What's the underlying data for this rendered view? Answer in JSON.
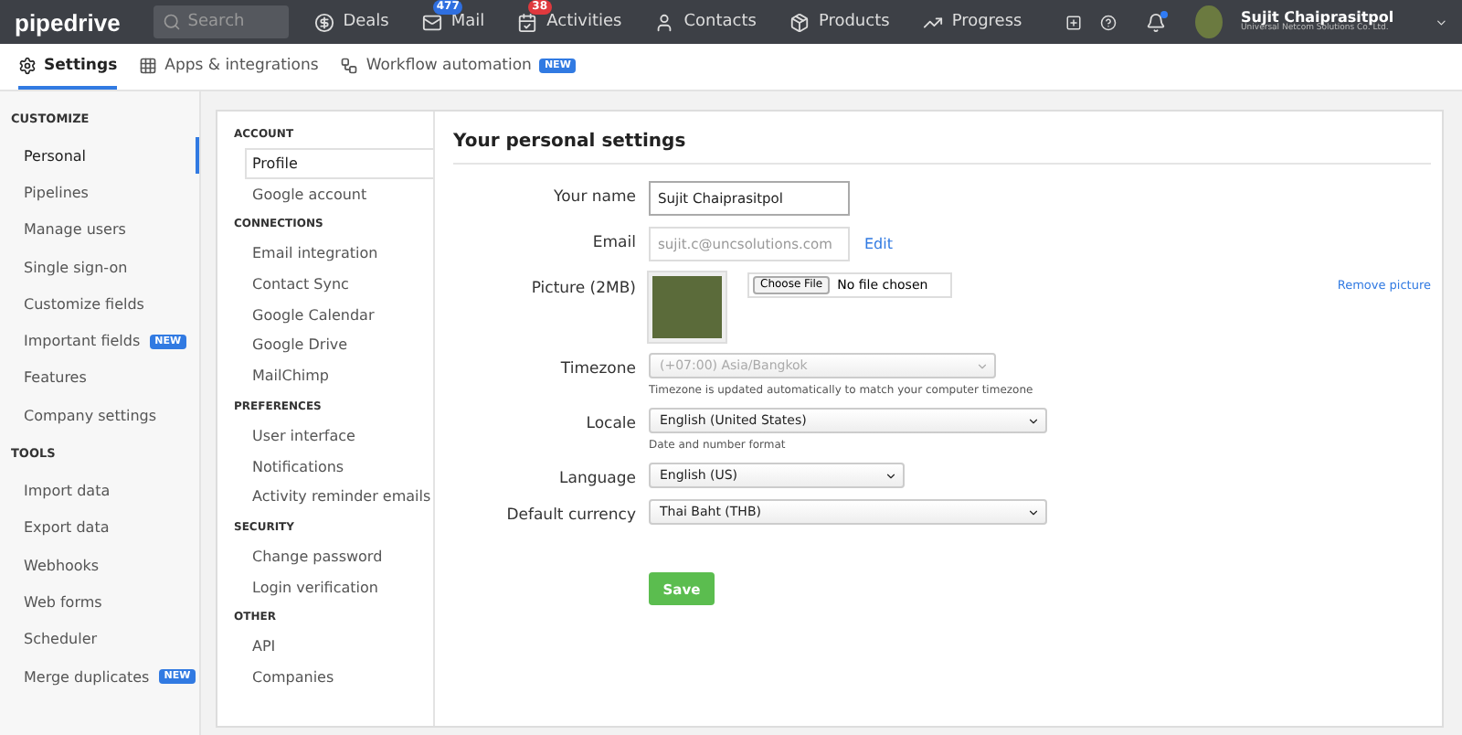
{
  "topbar": {
    "logo": "pipedrive",
    "search": {
      "placeholder": "Search"
    },
    "nav": [
      {
        "kind": "deals",
        "label": "Deals"
      },
      {
        "kind": "mail",
        "label": "Mail",
        "badge": "477",
        "color": "#2f6fe0"
      },
      {
        "kind": "activities",
        "label": "Activities",
        "badge": "38",
        "color": "#e0393e"
      },
      {
        "kind": "contacts",
        "label": "Contacts"
      },
      {
        "kind": "products",
        "label": "Products"
      },
      {
        "kind": "progress",
        "label": "Progress"
      }
    ],
    "notification_dot": true,
    "user": {
      "name": "Sujit Chaiprasitpol",
      "company": "Universal Netcom Solutions Co. Ltd."
    }
  },
  "tabs": [
    {
      "kind": "settings",
      "label": "Settings",
      "selected": true
    },
    {
      "kind": "apps",
      "label": "Apps & integrations",
      "selected": false
    },
    {
      "kind": "workflow",
      "label": "Workflow automation",
      "selected": false,
      "badge": "NEW"
    }
  ],
  "sidebar": [
    {
      "heading": "CUSTOMIZE",
      "items": [
        {
          "label": "Personal",
          "selected": true
        },
        {
          "label": "Pipelines",
          "selected": false
        },
        {
          "label": "Manage users",
          "selected": false
        },
        {
          "label": "Single sign-on",
          "selected": false
        },
        {
          "label": "Customize fields",
          "selected": false
        },
        {
          "label": "Important fields",
          "selected": false,
          "badge": "NEW"
        },
        {
          "label": "Features",
          "selected": false
        },
        {
          "label": "Company settings",
          "selected": false
        }
      ]
    },
    {
      "heading": "TOOLS",
      "items": [
        {
          "label": "Import data",
          "selected": false
        },
        {
          "label": "Export data",
          "selected": false
        },
        {
          "label": "Webhooks",
          "selected": false
        },
        {
          "label": "Web forms",
          "selected": false
        },
        {
          "label": "Scheduler",
          "selected": false
        },
        {
          "label": "Merge duplicates",
          "selected": false,
          "badge": "NEW"
        }
      ]
    }
  ],
  "settings_nav": [
    {
      "heading": "ACCOUNT",
      "items": [
        {
          "label": "Profile",
          "selected": true
        },
        {
          "label": "Google account",
          "selected": false
        }
      ]
    },
    {
      "heading": "CONNECTIONS",
      "items": [
        {
          "label": "Email integration",
          "selected": false
        },
        {
          "label": "Contact Sync",
          "selected": false
        },
        {
          "label": "Google Calendar",
          "selected": false
        },
        {
          "label": "Google Drive",
          "selected": false
        },
        {
          "label": "MailChimp",
          "selected": false
        }
      ]
    },
    {
      "heading": "PREFERENCES",
      "items": [
        {
          "label": "User interface",
          "selected": false
        },
        {
          "label": "Notifications",
          "selected": false
        },
        {
          "label": "Activity reminder emails",
          "selected": false
        }
      ]
    },
    {
      "heading": "SECURITY",
      "items": [
        {
          "label": "Change password",
          "selected": false
        },
        {
          "label": "Login verification",
          "selected": false
        }
      ]
    },
    {
      "heading": "OTHER",
      "items": [
        {
          "label": "API",
          "selected": false
        },
        {
          "label": "Companies",
          "selected": false
        }
      ]
    }
  ],
  "form": {
    "title": "Your personal settings",
    "fields": [
      {
        "kind": "text",
        "label": "Your name",
        "value": "Sujit Chaiprasitpol",
        "disabled": false
      },
      {
        "kind": "text",
        "label": "Email",
        "value": "sujit.c@uncsolutions.com",
        "disabled": true,
        "action": "Edit"
      },
      {
        "kind": "picture",
        "label": "Picture (2MB)",
        "button": "Choose File",
        "status": "No file chosen",
        "action": "Remove picture"
      },
      {
        "kind": "select",
        "label": "Timezone",
        "value": "(+07:00) Asia/Bangkok",
        "disabled": true,
        "hint": "Timezone is updated automatically to match your computer timezone"
      },
      {
        "kind": "select",
        "label": "Locale",
        "value": "English (United States)",
        "disabled": false,
        "hint": "Date and number format"
      },
      {
        "kind": "select",
        "label": "Language",
        "value": "English (US)",
        "disabled": false
      },
      {
        "kind": "select",
        "label": "Default currency",
        "value": "Thai Baht (THB)",
        "disabled": false
      }
    ],
    "save": "Save"
  }
}
